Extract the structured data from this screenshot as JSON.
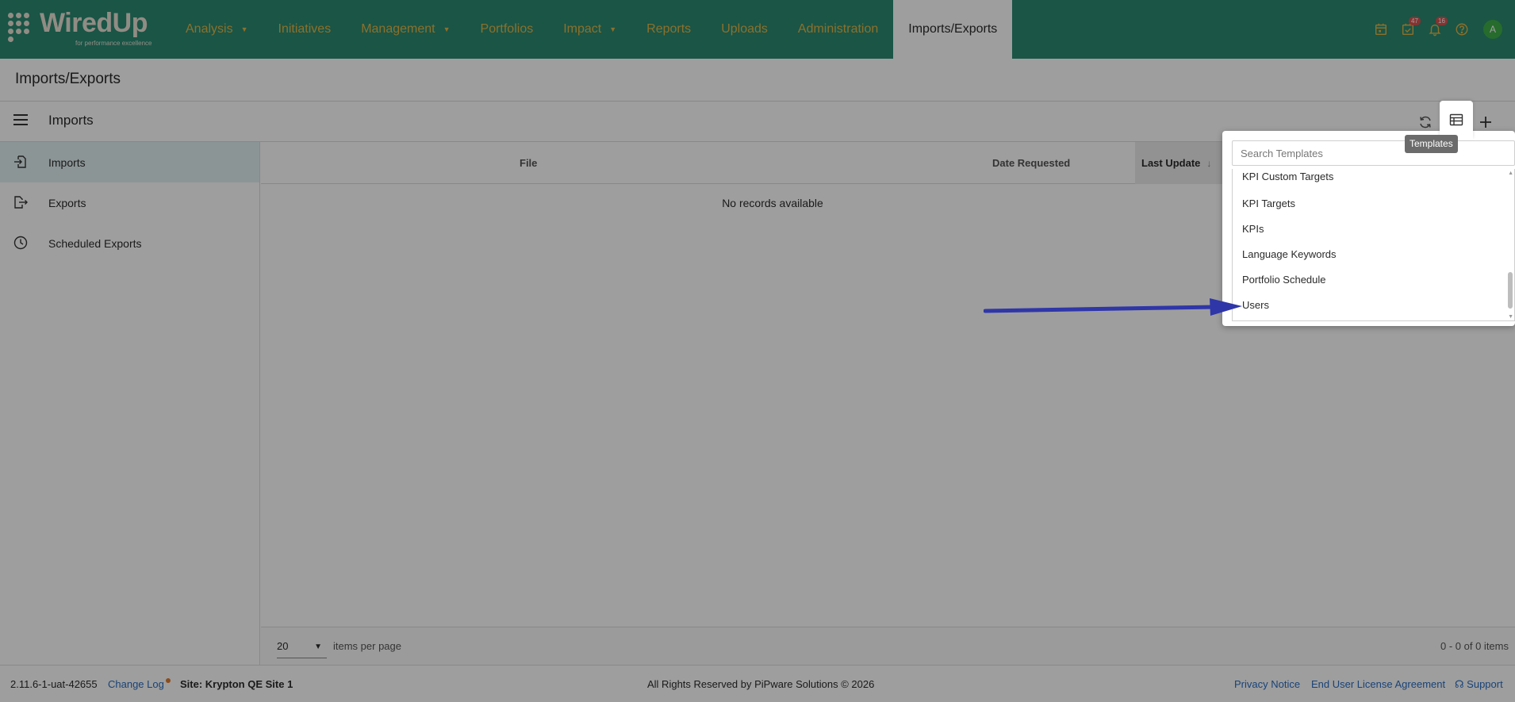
{
  "brand": {
    "name": "WiredUp",
    "tagline": "for performance excellence"
  },
  "nav": {
    "items": [
      {
        "label": "Analysis",
        "has_dropdown": true
      },
      {
        "label": "Initiatives",
        "has_dropdown": false
      },
      {
        "label": "Management",
        "has_dropdown": true
      },
      {
        "label": "Portfolios",
        "has_dropdown": false
      },
      {
        "label": "Impact",
        "has_dropdown": true
      },
      {
        "label": "Reports",
        "has_dropdown": false
      },
      {
        "label": "Uploads",
        "has_dropdown": false
      },
      {
        "label": "Administration",
        "has_dropdown": false
      },
      {
        "label": "Imports/Exports",
        "has_dropdown": false,
        "active": true
      }
    ],
    "icons": {
      "calendar": "calendar-icon",
      "tasks": "tasks-icon",
      "tasks_badge": "47",
      "notifications": "bell-icon",
      "notifications_badge": "16",
      "help": "help-icon",
      "avatar_initial": "A"
    }
  },
  "page": {
    "title": "Imports/Exports"
  },
  "section": {
    "title": "Imports",
    "tools": {
      "refresh": "refresh-icon",
      "templates": "table-icon",
      "add": "plus-icon"
    },
    "tooltip": "Templates"
  },
  "sidebar": {
    "items": [
      {
        "label": "Imports",
        "icon": "file-import-icon",
        "active": true
      },
      {
        "label": "Exports",
        "icon": "file-export-icon",
        "active": false
      },
      {
        "label": "Scheduled Exports",
        "icon": "clock-icon",
        "active": false
      }
    ]
  },
  "grid": {
    "columns": [
      {
        "label": "File"
      },
      {
        "label": "Date Requested"
      },
      {
        "label": "Last Update",
        "sorted": "desc"
      }
    ],
    "empty_text": "No records available",
    "pager": {
      "page_size": "20",
      "page_size_label": "items per page",
      "info": "0 - 0 of 0 items"
    }
  },
  "templates_popup": {
    "search_placeholder": "Search Templates",
    "items": [
      "KPI Custom Targets",
      "KPI Targets",
      "KPIs",
      "Language Keywords",
      "Portfolio Schedule",
      "Users"
    ]
  },
  "status_bar": {
    "version": "2.11.6-1-uat-42655",
    "change_log": "Change Log",
    "site": "Site: Krypton QE Site 1",
    "copyright": "All Rights Reserved by PiPware Solutions © 2026",
    "privacy": "Privacy Notice",
    "eula": "End User License Agreement",
    "support": "Support"
  },
  "colors": {
    "nav_bg": "#2a8a72",
    "nav_text": "#e2b546",
    "link": "#2a6cc0",
    "arrow": "#2f36a8",
    "active_sidebar": "#e3f1f3"
  }
}
